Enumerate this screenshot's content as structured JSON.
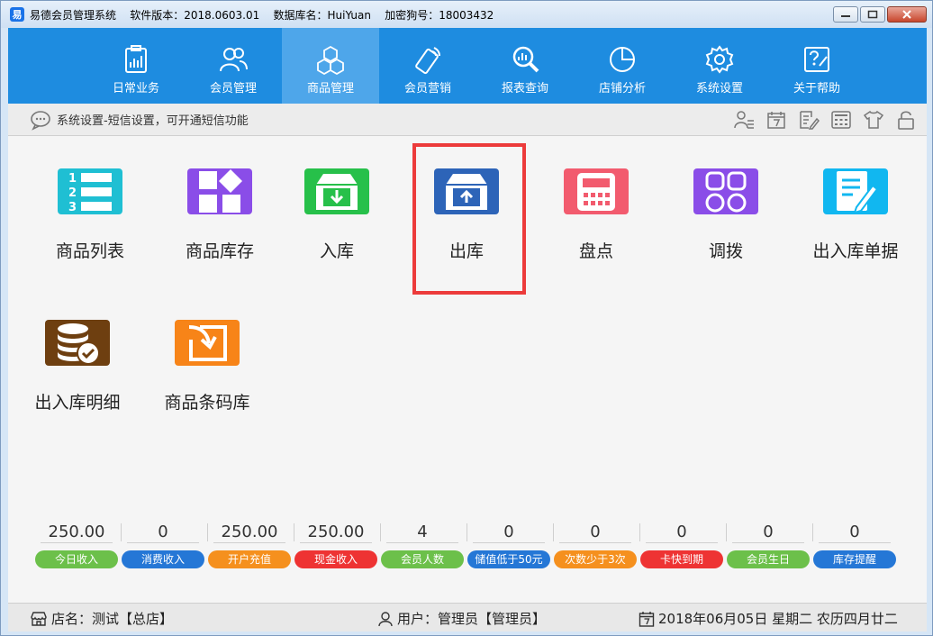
{
  "window": {
    "title": "易德会员管理系统    软件版本：2018.0603.01    数据库名：HuiYuan    加密狗号：18003432"
  },
  "nav": {
    "items": [
      {
        "label": "日常业务",
        "icon": "clipboard-chart-icon"
      },
      {
        "label": "会员管理",
        "icon": "users-icon"
      },
      {
        "label": "商品管理",
        "icon": "boxes-icon",
        "active": true
      },
      {
        "label": "会员营销",
        "icon": "phone-signal-icon"
      },
      {
        "label": "报表查询",
        "icon": "chart-search-icon"
      },
      {
        "label": "店铺分析",
        "icon": "pie-chart-icon"
      },
      {
        "label": "系统设置",
        "icon": "gear-icon"
      },
      {
        "label": "关于帮助",
        "icon": "help-icon"
      }
    ]
  },
  "breadcrumb": {
    "text": "系统设置-短信设置，可开通短信功能"
  },
  "tiles": [
    {
      "label": "商品列表",
      "color": "#1fbfd3",
      "icon": "numbered-list-icon"
    },
    {
      "label": "商品库存",
      "color": "#8a4de8",
      "icon": "grid-diamond-icon"
    },
    {
      "label": "入库",
      "color": "#27c04a",
      "icon": "box-in-icon"
    },
    {
      "label": "出库",
      "color": "#2d64b8",
      "icon": "box-out-icon",
      "selected": true
    },
    {
      "label": "盘点",
      "color": "#f25b6e",
      "icon": "calculator-icon"
    },
    {
      "label": "调拨",
      "color": "#8a4de8",
      "icon": "apps-icon"
    },
    {
      "label": "出入库单据",
      "color": "#11b7f0",
      "icon": "document-edit-icon"
    },
    {
      "label": "出入库明细",
      "color": "#6e3f10",
      "icon": "database-check-icon"
    },
    {
      "label": "商品条码库",
      "color": "#f78418",
      "icon": "import-icon"
    }
  ],
  "stats": [
    {
      "value": "250.00",
      "label": "今日收入",
      "color": "#6cc04a"
    },
    {
      "value": "0",
      "label": "消费收入",
      "color": "#2577d6"
    },
    {
      "value": "250.00",
      "label": "开户充值",
      "color": "#f5901e"
    },
    {
      "value": "250.00",
      "label": "现金收入",
      "color": "#ee3333"
    },
    {
      "value": "4",
      "label": "会员人数",
      "color": "#6cc04a"
    },
    {
      "value": "0",
      "label": "储值低于50元",
      "color": "#2577d6"
    },
    {
      "value": "0",
      "label": "次数少于3次",
      "color": "#f5901e"
    },
    {
      "value": "0",
      "label": "卡快到期",
      "color": "#ee3333"
    },
    {
      "value": "0",
      "label": "会员生日",
      "color": "#6cc04a"
    },
    {
      "value": "0",
      "label": "库存提醒",
      "color": "#2577d6"
    }
  ],
  "status": {
    "store": "店名：测试【总店】",
    "user": "用户：管理员【管理员】",
    "date": "2018年06月05日 星期二 农历四月廿二"
  }
}
